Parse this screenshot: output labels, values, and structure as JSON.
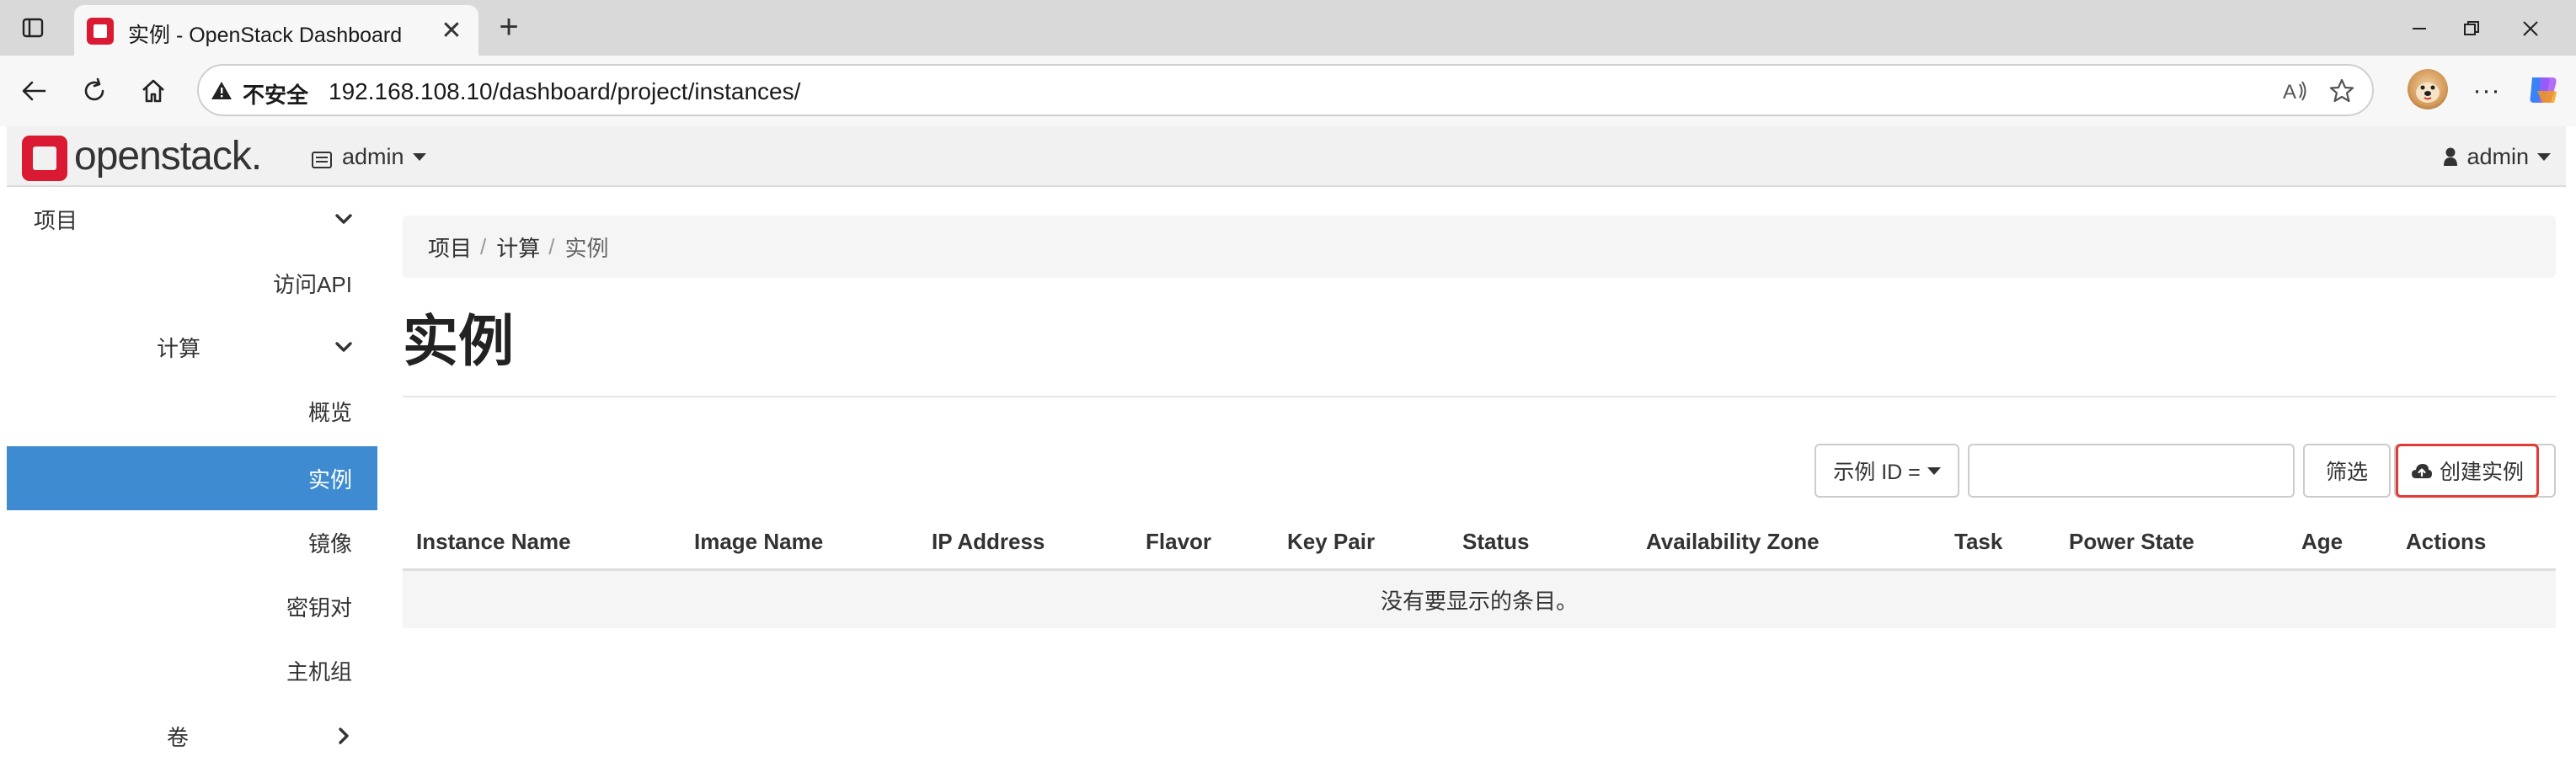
{
  "browser": {
    "tab_title": "实例 - OpenStack Dashboard",
    "tab_close": "✕",
    "new_tab": "+",
    "insecure_label": "不安全",
    "url": "192.168.108.10/dashboard/project/instances/",
    "more": "···"
  },
  "navbar": {
    "logo_text": "openstack.",
    "project_label": "admin",
    "user_label": "admin"
  },
  "sidebar": {
    "items": [
      {
        "label": "项目",
        "chevron": "down"
      },
      {
        "label": "访问API"
      },
      {
        "label": "计算",
        "chevron": "down"
      },
      {
        "label": "概览"
      },
      {
        "label": "实例",
        "active": true
      },
      {
        "label": "镜像"
      },
      {
        "label": "密钥对"
      },
      {
        "label": "主机组"
      },
      {
        "label": "卷",
        "chevron": "right"
      }
    ]
  },
  "breadcrumb": {
    "items": [
      "项目",
      "计算",
      "实例"
    ],
    "separator": "/"
  },
  "page": {
    "title": "实例"
  },
  "filter": {
    "select_label": "示例 ID =",
    "input_value": "",
    "filter_button": "筛选",
    "create_button": "创建实例"
  },
  "table": {
    "columns": [
      "Instance Name",
      "Image Name",
      "IP Address",
      "Flavor",
      "Key Pair",
      "Status",
      "Availability Zone",
      "Task",
      "Power State",
      "Age",
      "Actions"
    ],
    "empty_message": "没有要显示的条目。"
  },
  "colors": {
    "active_sidebar": "#3f8bd1",
    "openstack_red": "#da1a32",
    "highlight_border": "#e53935"
  }
}
